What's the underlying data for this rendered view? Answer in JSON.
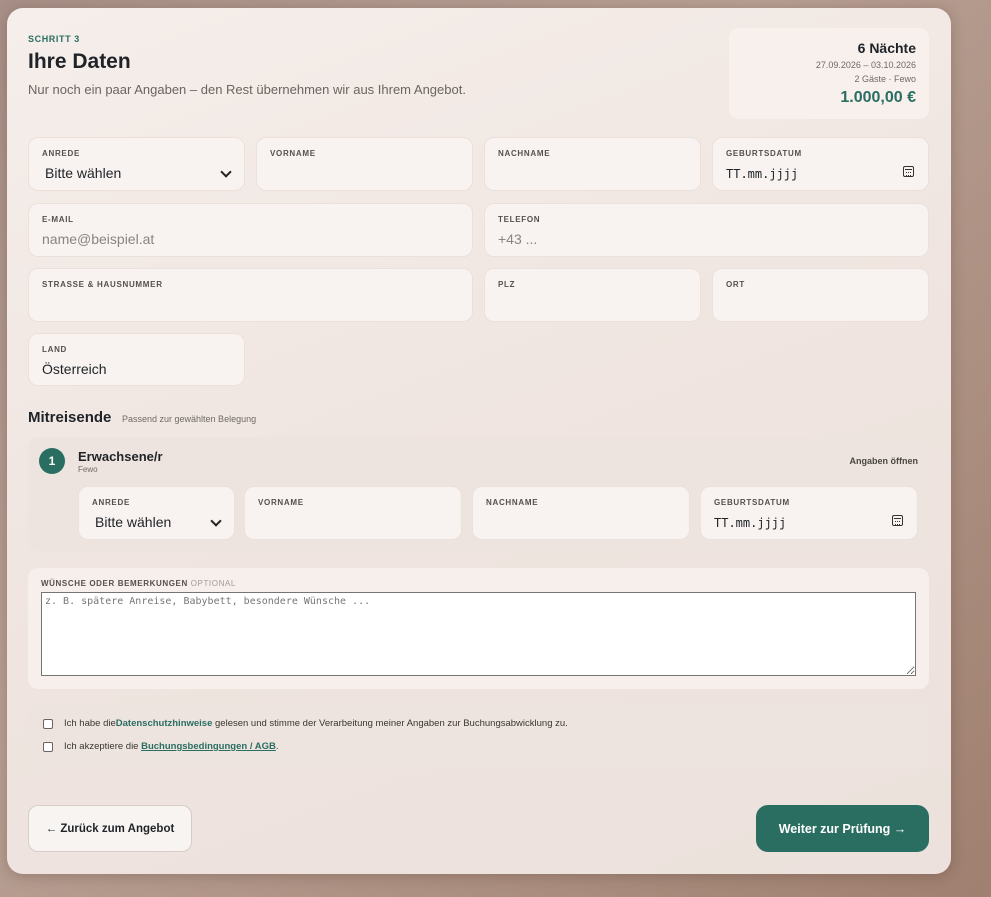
{
  "header": {
    "step": "SCHRITT 3",
    "title": "Ihre Daten",
    "subtitle": "Nur noch ein paar Angaben – den Rest übernehmen wir aus Ihrem Angebot."
  },
  "summary": {
    "nights": "6 Nächte",
    "dates": "27.09.2026 – 03.10.2026",
    "guests": "2 Gäste · Fewo",
    "price": "1.000,00 €"
  },
  "form": {
    "salutation_label": "ANREDE",
    "salutation_value": "Bitte wählen",
    "firstname_label": "VORNAME",
    "lastname_label": "NACHNAME",
    "birthdate_label": "GEBURTSDATUM",
    "birthdate_placeholder": "TT.mm.jjjj",
    "email_label": "E-MAIL",
    "email_placeholder": "name@beispiel.at",
    "phone_label": "TELEFON",
    "phone_placeholder": "+43 ...",
    "street_label": "STRASSE & HAUSNUMMER",
    "zip_label": "PLZ",
    "city_label": "ORT",
    "country_label": "LAND",
    "country_value": "Österreich"
  },
  "travelers": {
    "title": "Mitreisende",
    "subtitle": "Passend zur gewählten Belegung",
    "items": [
      {
        "number": "1",
        "title": "Erwachsene/r",
        "sub": "Fewo",
        "open_label": "Angaben öffnen",
        "salutation_label": "ANREDE",
        "salutation_value": "Bitte wählen",
        "firstname_label": "VORNAME",
        "lastname_label": "NACHNAME",
        "birthdate_label": "GEBURTSDATUM",
        "birthdate_placeholder": "TT.mm.jjjj"
      }
    ]
  },
  "wishes": {
    "label": "WÜNSCHE ODER BEMERKUNGEN",
    "optional": "OPTIONAL",
    "placeholder": "z. B. spätere Anreise, Babybett, besondere Wünsche ..."
  },
  "consents": {
    "privacy_pre": "Ich habe die ",
    "privacy_link": "Datenschutzhinweise",
    "privacy_post": " gelesen und stimme der Verarbeitung meiner Angaben zur Buchungsabwicklung zu.",
    "terms_pre": "Ich akzeptiere die ",
    "terms_link": "Buchungsbedingungen / AGB",
    "terms_post": "."
  },
  "actions": {
    "back_label": "← Zurück zum Angebot",
    "next_label": "Weiter zur Prüfung →"
  },
  "colors": {
    "accent": "#2a6e62",
    "background": "#efe4df"
  }
}
